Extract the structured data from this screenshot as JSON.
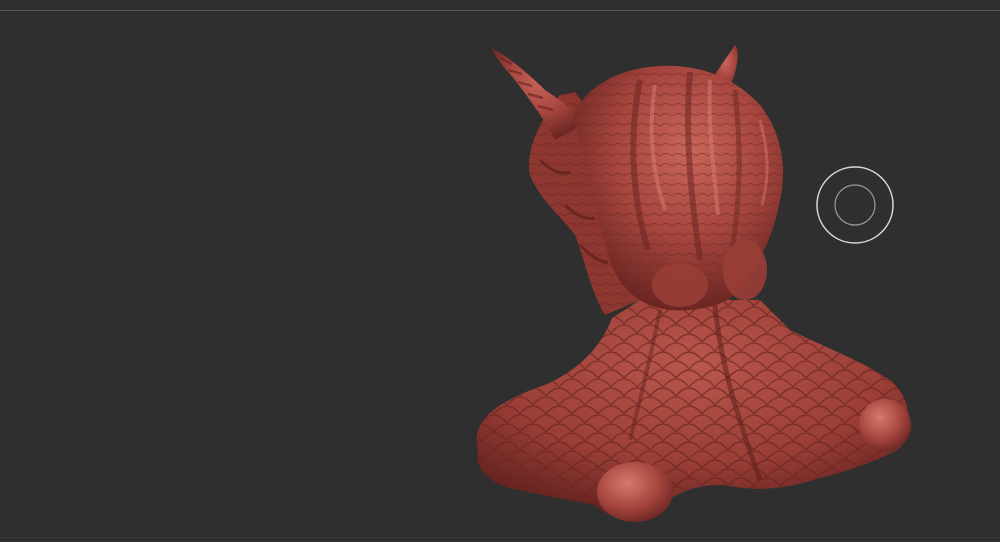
{
  "app": {
    "name": "",
    "viewport_background": "#2f2f2f"
  },
  "canvas": {
    "model": {
      "icon": "sculpted-creature-bust",
      "material_color": "#a5453e",
      "highlight_color": "#d07a6e",
      "shadow_color": "#5e1f1c"
    },
    "brush_cursor": {
      "icon": "brush-radius-cursor",
      "color": "#d8d8d8"
    }
  }
}
